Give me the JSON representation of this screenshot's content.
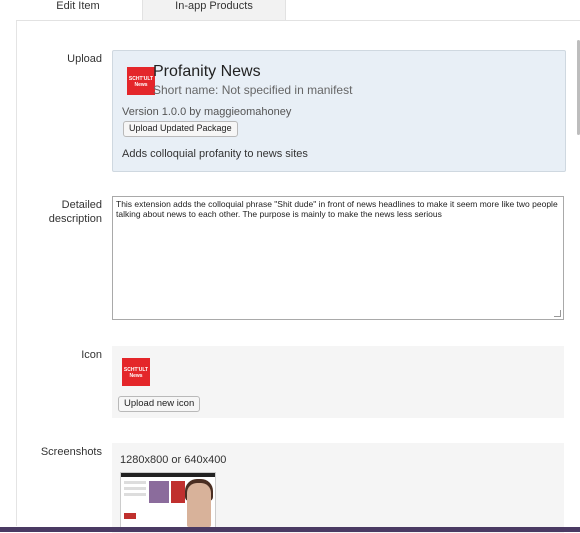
{
  "tabs": [
    {
      "label": "Edit Item"
    },
    {
      "label": "In-app Products"
    }
  ],
  "upload": {
    "label": "Upload",
    "icon_text": "SCHT'ULT News",
    "app_name": "Profanity News",
    "short_name": "Short name: Not specified in manifest",
    "version": "Version 1.0.0 by maggieomahoney",
    "upload_button": "Upload Updated Package",
    "short_description": "Adds colloquial profanity to news sites"
  },
  "detailed": {
    "label_line1": "Detailed",
    "label_line2": "description",
    "text": "This extension adds the colloquial phrase \"Shit dude\" in front of news headlines to make it seem more like two people talking about news to each other. The purpose is mainly to make the news less serious"
  },
  "icon_section": {
    "label": "Icon",
    "icon_text": "SCHT'ULT News",
    "upload_button": "Upload new icon"
  },
  "screenshots": {
    "label": "Screenshots",
    "size_hint": "1280x800 or 640x400"
  },
  "colors": {
    "accent_red": "#e4262a",
    "upload_box_bg": "#e8eff6",
    "bottom_strip": "#4a3a63"
  }
}
